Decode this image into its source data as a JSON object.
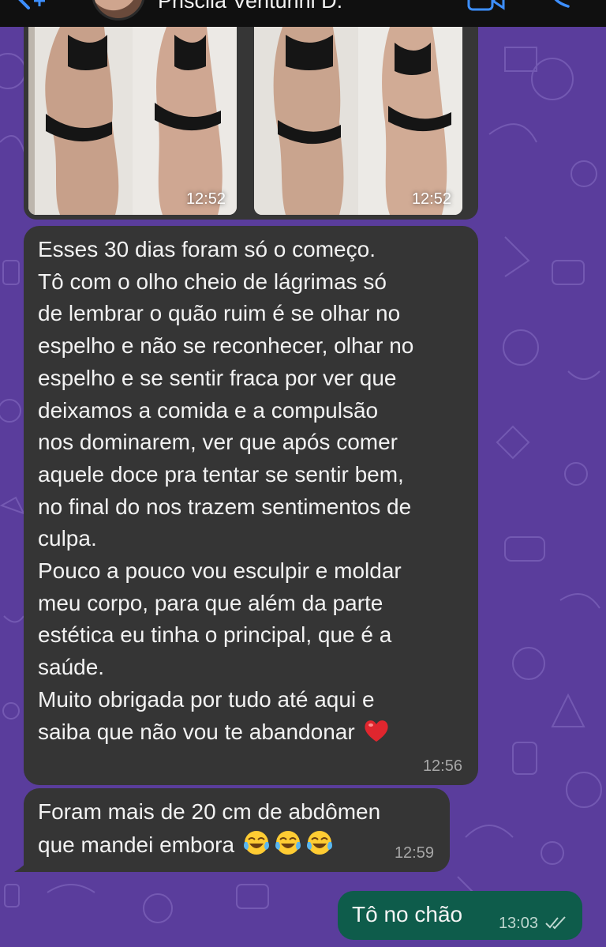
{
  "header": {
    "contact_name": "Priscila Venturini D."
  },
  "image_message": {
    "photos": [
      {
        "time": "12:52"
      },
      {
        "time": "12:52"
      }
    ]
  },
  "messages": [
    {
      "direction": "incoming",
      "text": "Esses 30 dias foram só o começo.\nTô com o olho cheio de lágrimas só\nde lembrar o quão ruim é se olhar no\nespelho e não se reconhecer, olhar no\nespelho e se sentir fraca por ver que\ndeixamos a comida e a compulsão\nnos dominarem, ver que após comer\naquele doce pra tentar se sentir bem,\nno final do nos trazem sentimentos de\nculpa.\nPouco a pouco vou esculpir e moldar\nmeu corpo, para que além da parte\nestética eu tinha o principal, que é a\nsaúde.\nMuito obrigada por tudo até aqui e\nsaiba que não vou te abandonar",
      "emoji": "red-heart",
      "time": "12:56"
    },
    {
      "direction": "incoming",
      "text": "Foram mais de 20 cm de abdômen\nque mandei embora",
      "emoji": "tears-of-joy x3",
      "time": "12:59"
    },
    {
      "direction": "outgoing",
      "text": "Tô no chão",
      "time": "13:03",
      "status": "read-checks"
    }
  ],
  "colors": {
    "wallpaper": "#5a3d9c",
    "incoming_bubble": "#353535",
    "outgoing_bubble": "#0e5c4b",
    "header": "#101010"
  }
}
